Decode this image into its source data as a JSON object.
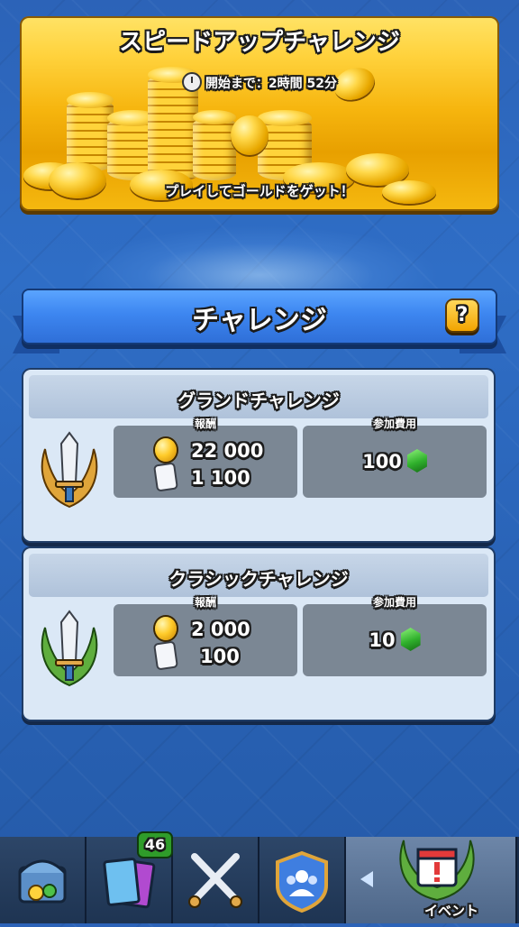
{
  "speed_challenge": {
    "title": "スピードアップチャレンジ",
    "timer": "開始まで：2時間 52分",
    "footer": "プレイしてゴールドをゲット！"
  },
  "section": {
    "title": "チャレンジ",
    "help_label": "?"
  },
  "challenges": [
    {
      "title": "グランドチャレンジ",
      "reward_label": "報酬",
      "gold": "22 000",
      "cards": "1 100",
      "fee_label": "参加費用",
      "fee": "100",
      "badge_color": "#e0a53a"
    },
    {
      "title": "クラシックチャレンジ",
      "reward_label": "報酬",
      "gold": "2 000",
      "cards": "100",
      "fee_label": "参加費用",
      "fee": "10",
      "badge_color": "#5fae3e"
    }
  ],
  "nav": {
    "cards_count": "46",
    "active_label": "イベント",
    "icons": [
      "shop-chest-icon",
      "cards-icon",
      "battle-swords-icon",
      "clan-icon",
      "events-calendar-icon"
    ]
  },
  "colors": {
    "background": "#2f6ec6",
    "banner": "#f6b50e",
    "ribbon": "#3d86f0",
    "gem": "#2fb02c"
  }
}
